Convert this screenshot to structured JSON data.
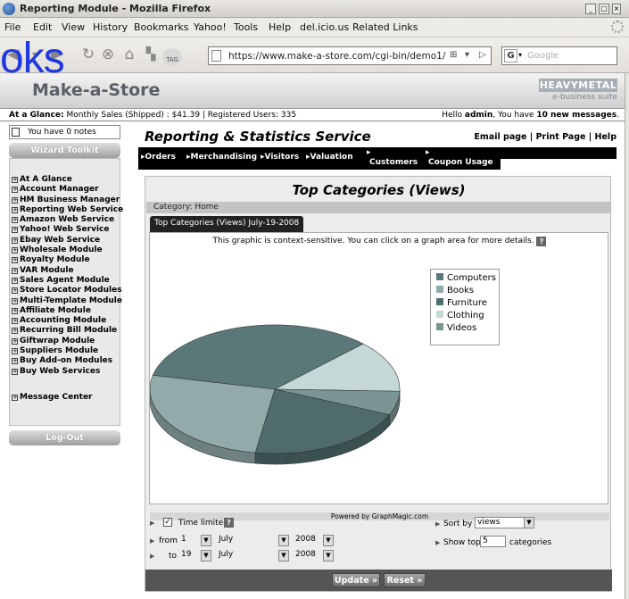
{
  "window": {
    "title": "Reporting Module - Mozilla Firefox"
  },
  "menu": [
    "File",
    "Edit",
    "View",
    "History",
    "Bookmarks",
    "Yahoo!",
    "Tools",
    "Help",
    "del.icio.us",
    "Related Links"
  ],
  "nav": {
    "url": "https://www.make-a-store.com/cgi-bin/demo1/",
    "tag_label": "TAG",
    "search_engine": "G",
    "search_placeholder": "Google"
  },
  "overlay_text": "oks",
  "site": {
    "logo": "Make-a-Store",
    "badge_top": "HEAVYMETAL",
    "badge_bottom": "e-business suite"
  },
  "glance": {
    "label": "At a Glance:",
    "text": "Monthly Sales (Shipped) : $41.39 | Registered Users: 335",
    "hello": "Hello",
    "user": "admin",
    "have": ", You have",
    "messages": "10 new messages",
    "period": "."
  },
  "sidebar": {
    "notes": "You have 0 notes",
    "wizard": "Wizard Toolkit",
    "items": [
      "At A Glance",
      "Account Manager",
      "HM Business Manager",
      "Reporting Web Service",
      "Amazon Web Service",
      "Yahoo! Web Service",
      "Ebay Web Service",
      "Wholesale Module",
      "Royalty Module",
      "VAR Module",
      "Sales Agent Module",
      "Store Locator Modules",
      "Multi-Template Module",
      "Affiliate Module",
      "Accounting Module",
      "Recurring Bill Module",
      "Giftwrap Module",
      "Suppliers Module",
      "Buy Add-on Modules",
      "Buy Web Services"
    ],
    "message_center": "Message Center",
    "logout": "Log-Out"
  },
  "content": {
    "title": "Reporting & Statistics Service",
    "links": "Email page | Print Page | Help",
    "tabs": [
      "Orders",
      "Merchandising",
      "Visitors",
      "Valuation",
      "Customers",
      "Coupon Usage"
    ]
  },
  "report": {
    "heading": "Top Categories (Views)",
    "category": "Category:  Home",
    "tab": "Top Categories (Views) July-19-2008",
    "note": "This graphic is context-sensitive. You can click on a graph area for more details.",
    "help_icon": "?",
    "powered": "Powered by GraphMagic.com"
  },
  "chart_data": {
    "type": "pie",
    "categories": [
      "Computers",
      "Books",
      "Furniture",
      "Clothing",
      "Videos"
    ],
    "values": [
      34,
      26,
      21,
      13,
      6
    ],
    "colors": [
      "#5b7878",
      "#93aaaa",
      "#4f6b6b",
      "#c4d8d8",
      "#7b9494"
    ],
    "legend": "right"
  },
  "controls": {
    "time_limited": "Time limited",
    "from_label": "from",
    "to_label": "to",
    "from_day": "1",
    "from_month": "July",
    "from_year": "2008",
    "to_day": "19",
    "to_month": "July",
    "to_year": "2008",
    "sort_label": "Sort by",
    "sort_value": "views",
    "show_label": "Show top",
    "show_value": "5",
    "show_suffix": "categories",
    "update": "Update »",
    "reset": "Reset »"
  }
}
